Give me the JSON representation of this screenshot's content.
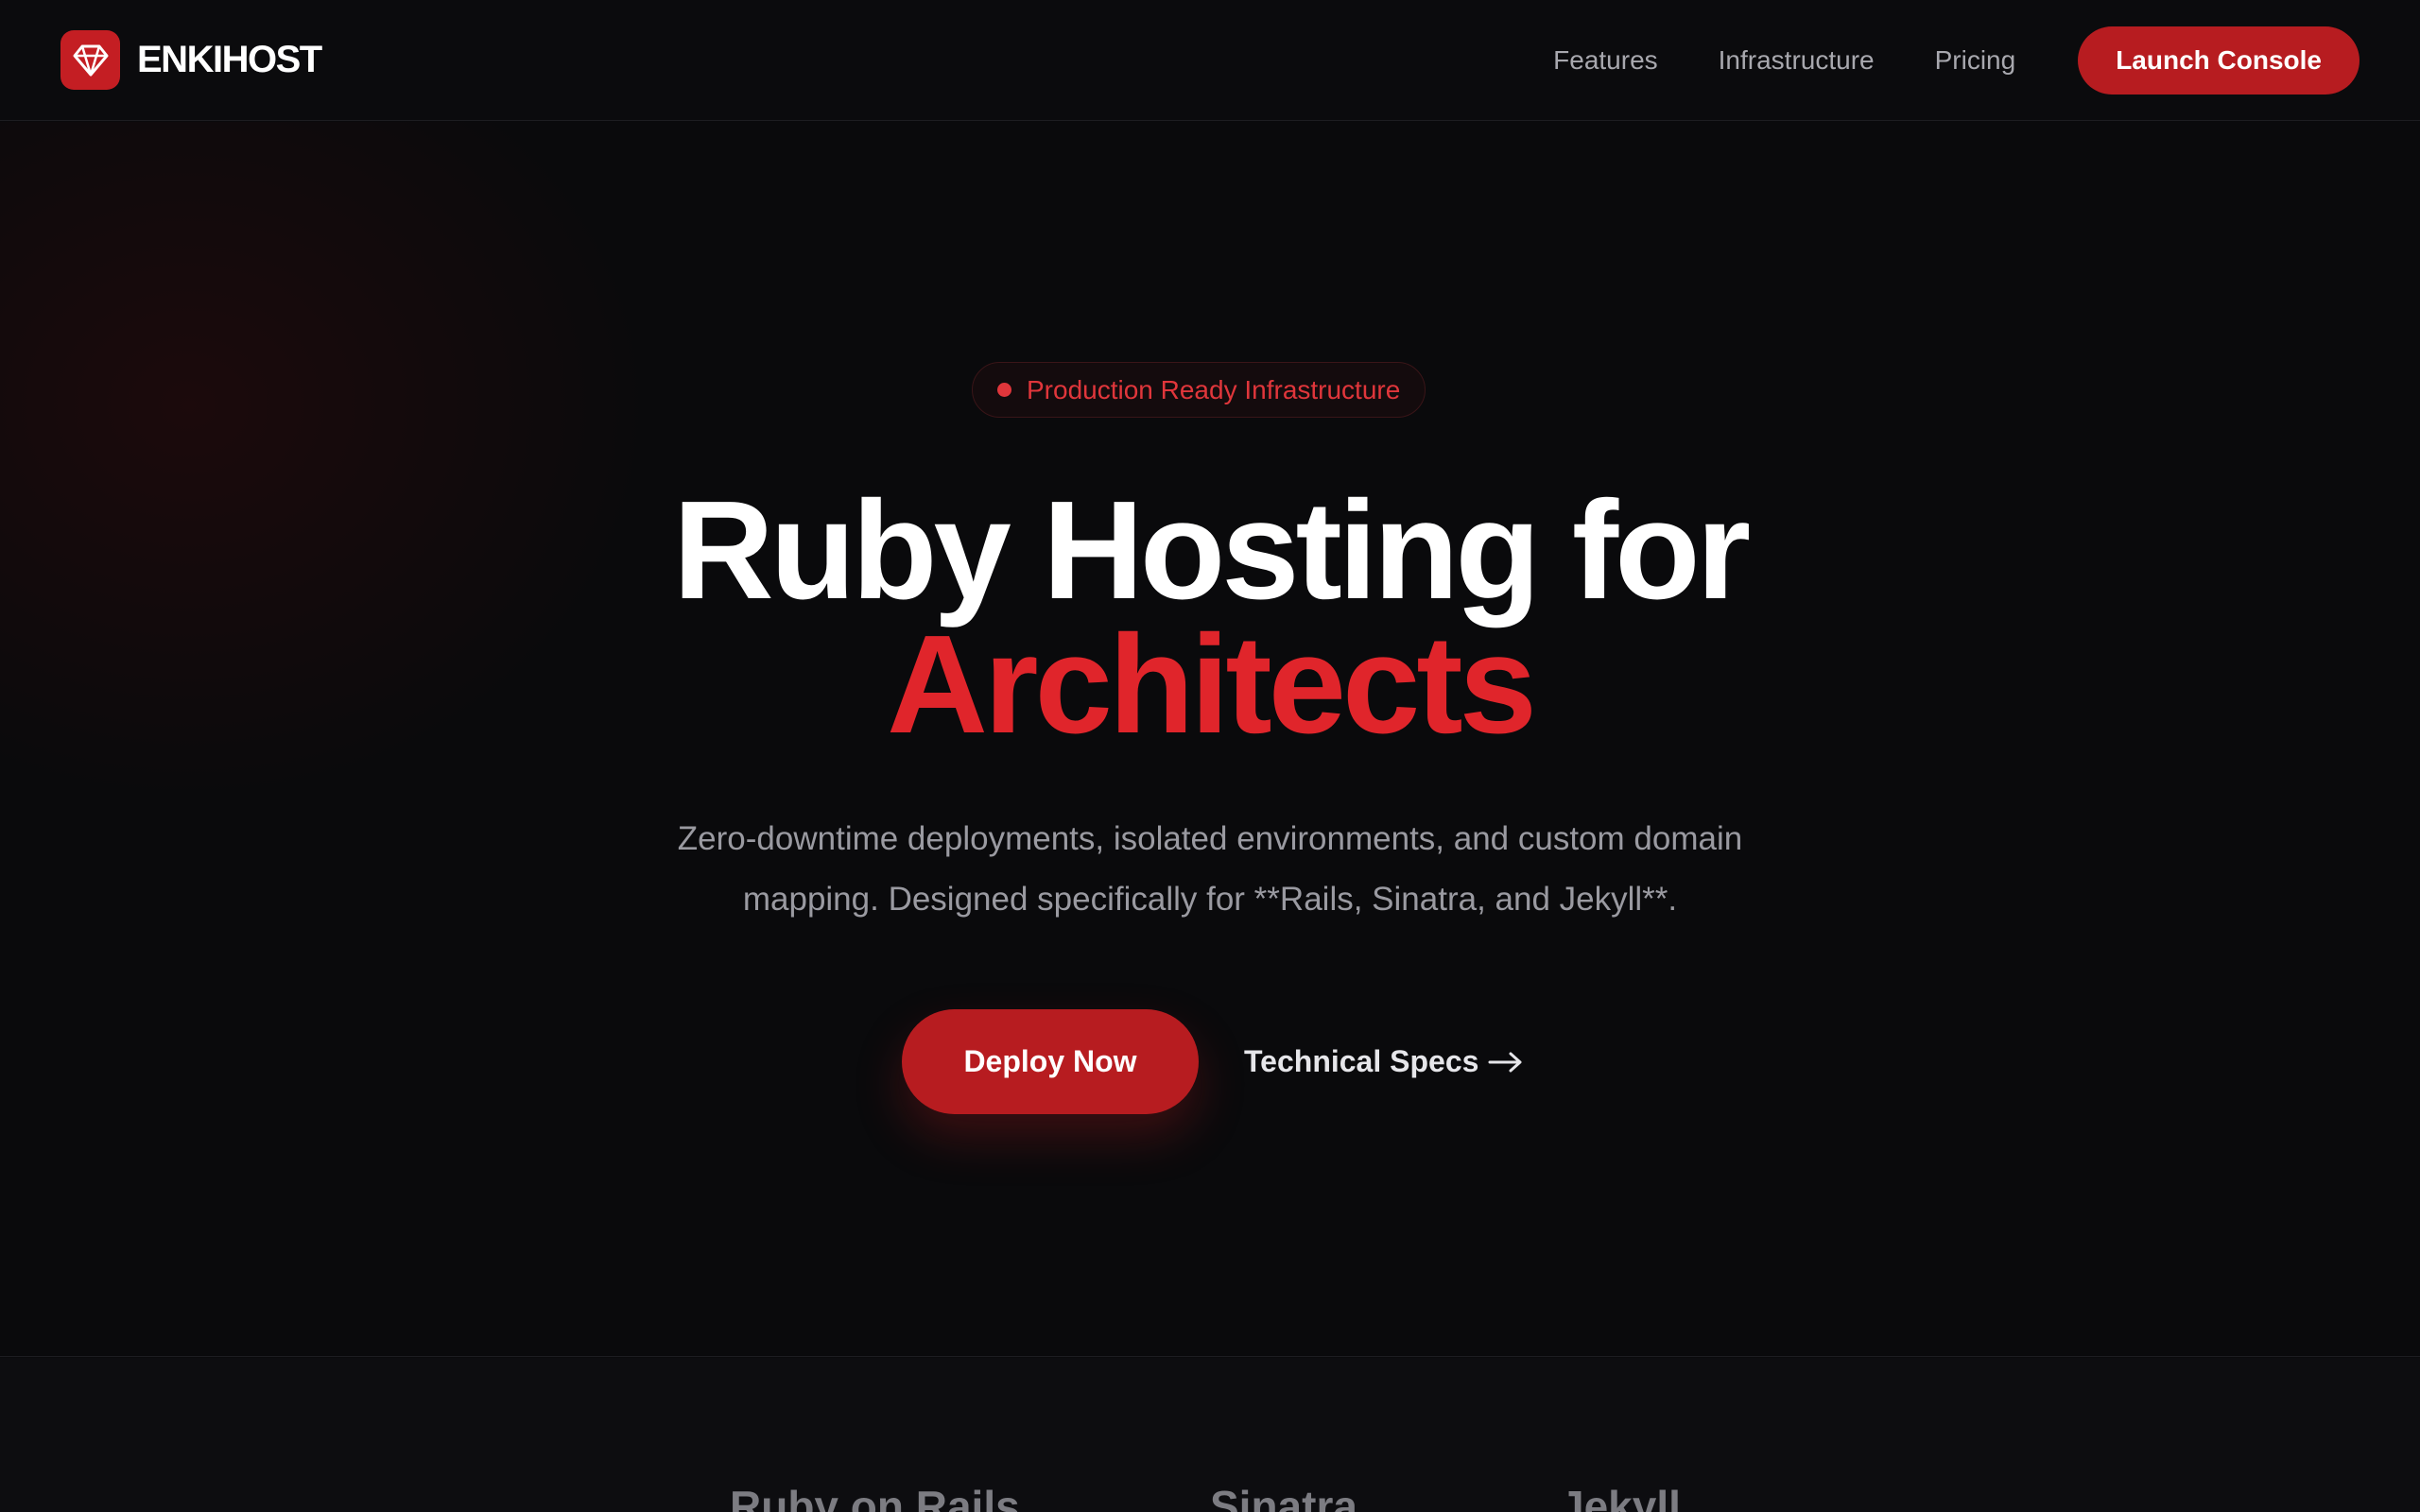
{
  "brand": {
    "name": "ENKIHOST",
    "icon": "ruby-gem-icon",
    "color": "#c41e23"
  },
  "nav": {
    "links": [
      "Features",
      "Infrastructure",
      "Pricing"
    ],
    "cta": "Launch Console"
  },
  "hero": {
    "badge": "Production Ready Infrastructure",
    "title_line1": "Ruby Hosting for",
    "title_line2": "Architects",
    "subtitle_line1": "Zero-downtime deployments, isolated environments, and custom domain",
    "subtitle_line2": "mapping. Designed specifically for **Rails, Sinatra, and Jekyll**.",
    "primary_cta": "Deploy Now",
    "secondary_cta": "Technical Specs",
    "secondary_icon": "arrow-right-icon"
  },
  "frameworks": [
    "Ruby on Rails",
    "Sinatra",
    "Jekyll"
  ],
  "colors": {
    "accent": "#e0252b",
    "button": "#b71c20",
    "background": "#0a0a0c"
  }
}
